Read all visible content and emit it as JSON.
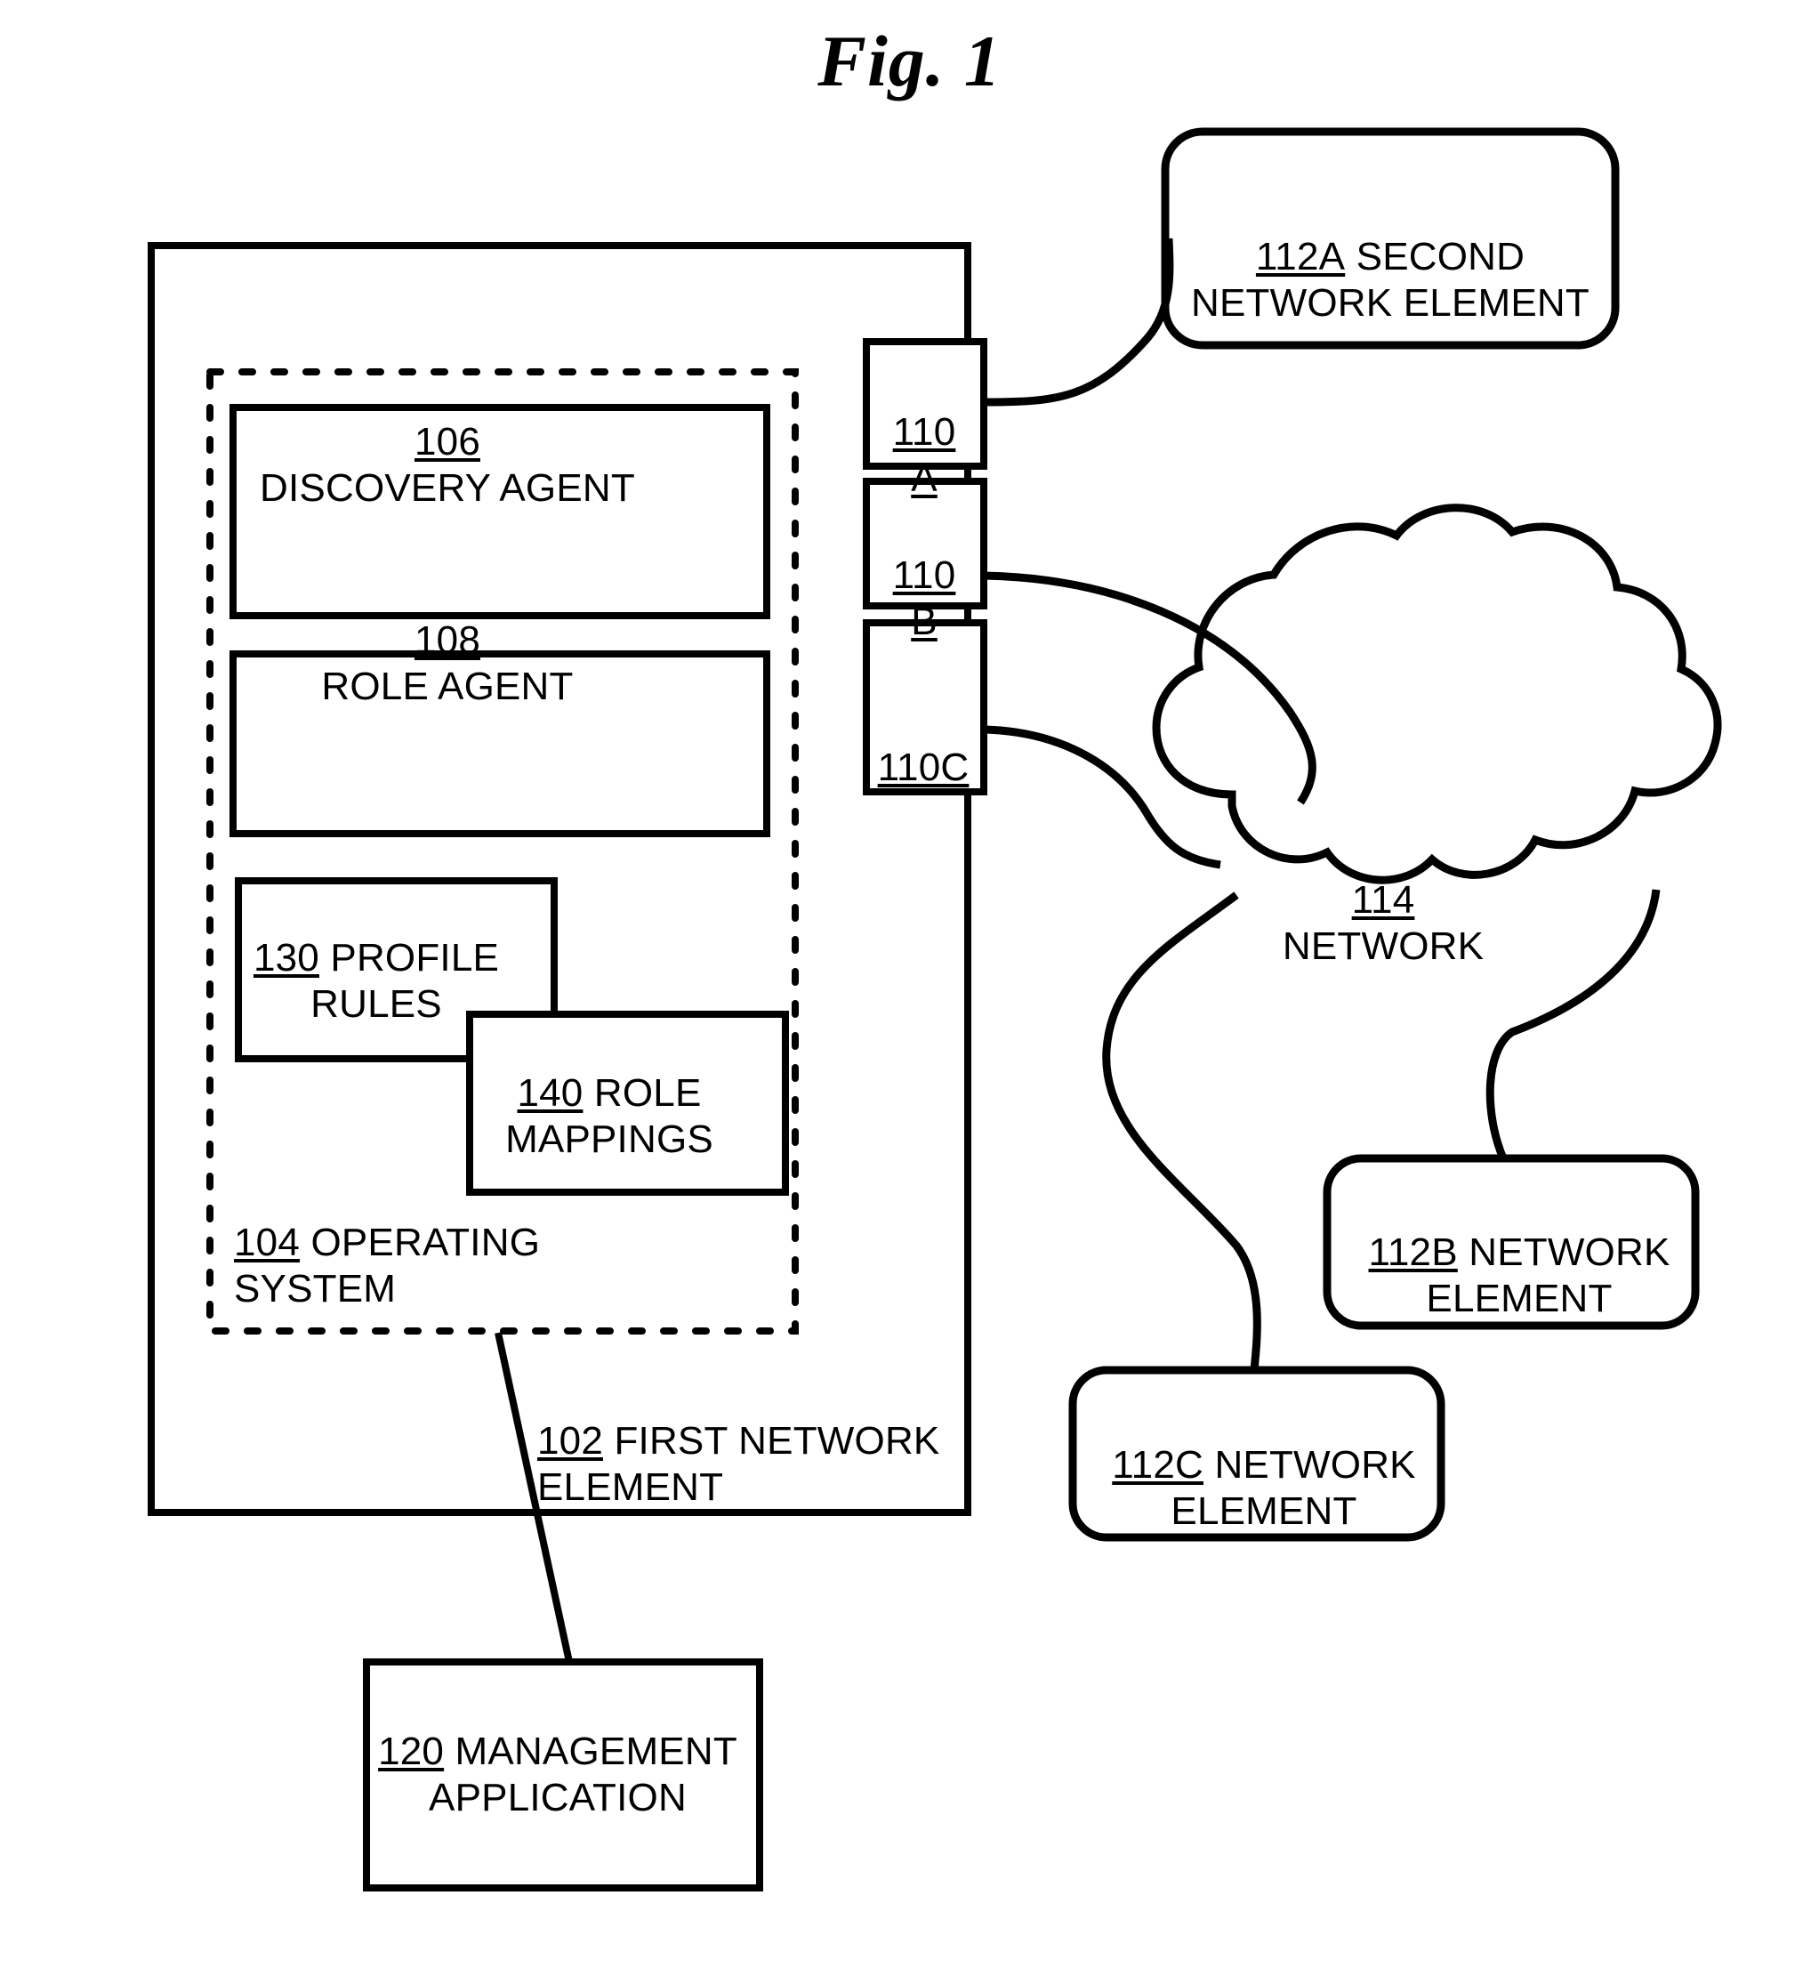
{
  "figure": {
    "title": "Fig. 1",
    "type": "patent-diagram"
  },
  "blocks": {
    "first_network_element": {
      "ref": "102",
      "label": "FIRST NETWORK",
      "label_line2": "ELEMENT",
      "full_text": "102 FIRST NETWORK ELEMENT"
    },
    "operating_system": {
      "ref": "104",
      "label": "OPERATING",
      "label_line2": "SYSTEM",
      "full_text": "104 OPERATING SYSTEM"
    },
    "discovery_agent": {
      "ref": "106",
      "label": "DISCOVERY AGENT",
      "full_text": "106 DISCOVERY AGENT"
    },
    "role_agent": {
      "ref": "108",
      "label": "ROLE AGENT",
      "full_text": "108 ROLE AGENT"
    },
    "profile_rules": {
      "ref": "130",
      "label": "PROFILE",
      "label_line2": "RULES",
      "full_text": "130 PROFILE RULES"
    },
    "role_mappings": {
      "ref": "140",
      "label": "ROLE",
      "label_line2": "MAPPINGS",
      "full_text": "140 ROLE MAPPINGS"
    },
    "management_application": {
      "ref": "120",
      "label": "MANAGEMENT",
      "label_line2": "APPLICATION",
      "full_text": "120 MANAGEMENT APPLICATION"
    },
    "port_a": {
      "ref": "110",
      "suffix": "A",
      "full_text": "110 A"
    },
    "port_b": {
      "ref": "110",
      "suffix": "B",
      "full_text": "110 B"
    },
    "port_c": {
      "ref": "110C",
      "suffix": "",
      "full_text": "110C"
    },
    "second_network_element": {
      "ref": "112A",
      "label": "SECOND",
      "label_line2": "NETWORK ELEMENT",
      "full_text": "112A SECOND NETWORK ELEMENT"
    },
    "network_cloud": {
      "ref": "114",
      "label": "NETWORK",
      "full_text": "114 NETWORK"
    },
    "network_element_b": {
      "ref": "112B",
      "label": "NETWORK",
      "label_line2": "ELEMENT",
      "full_text": "112B NETWORK ELEMENT"
    },
    "network_element_c": {
      "ref": "112C",
      "label": "NETWORK",
      "label_line2": "ELEMENT",
      "full_text": "112C NETWORK ELEMENT"
    }
  },
  "colors": {
    "stroke": "#000000",
    "background": "#ffffff"
  }
}
